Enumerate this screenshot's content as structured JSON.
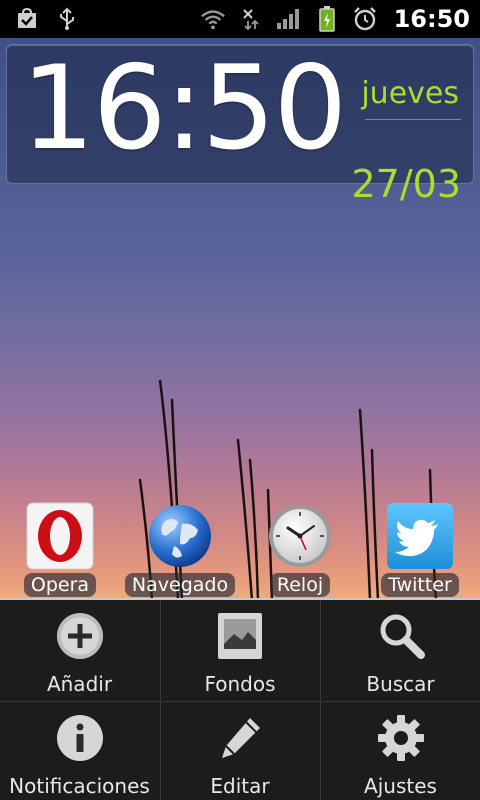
{
  "status_bar": {
    "time": "16:50",
    "left_icons": [
      "shopping-bag-check-icon",
      "usb-icon"
    ],
    "right_icons": [
      "wifi-icon",
      "data-transfer-icon",
      "signal-bars-icon",
      "battery-charging-icon",
      "alarm-clock-icon"
    ]
  },
  "clock_widget": {
    "time": "16:50",
    "day": "jueves",
    "date": "27/03",
    "accent_color": "#a6e02a"
  },
  "apps": [
    {
      "label": "Opera",
      "icon": "opera-icon"
    },
    {
      "label": "Navegado",
      "icon": "browser-globe-icon"
    },
    {
      "label": "Reloj",
      "icon": "clock-icon"
    },
    {
      "label": "Twitter",
      "icon": "twitter-icon"
    }
  ],
  "menu": {
    "items": [
      {
        "label": "Añadir",
        "icon": "add-icon"
      },
      {
        "label": "Fondos",
        "icon": "wallpaper-icon"
      },
      {
        "label": "Buscar",
        "icon": "search-icon"
      },
      {
        "label": "Notificaciones",
        "icon": "info-icon"
      },
      {
        "label": "Editar",
        "icon": "pencil-icon"
      },
      {
        "label": "Ajustes",
        "icon": "gear-icon"
      }
    ]
  }
}
